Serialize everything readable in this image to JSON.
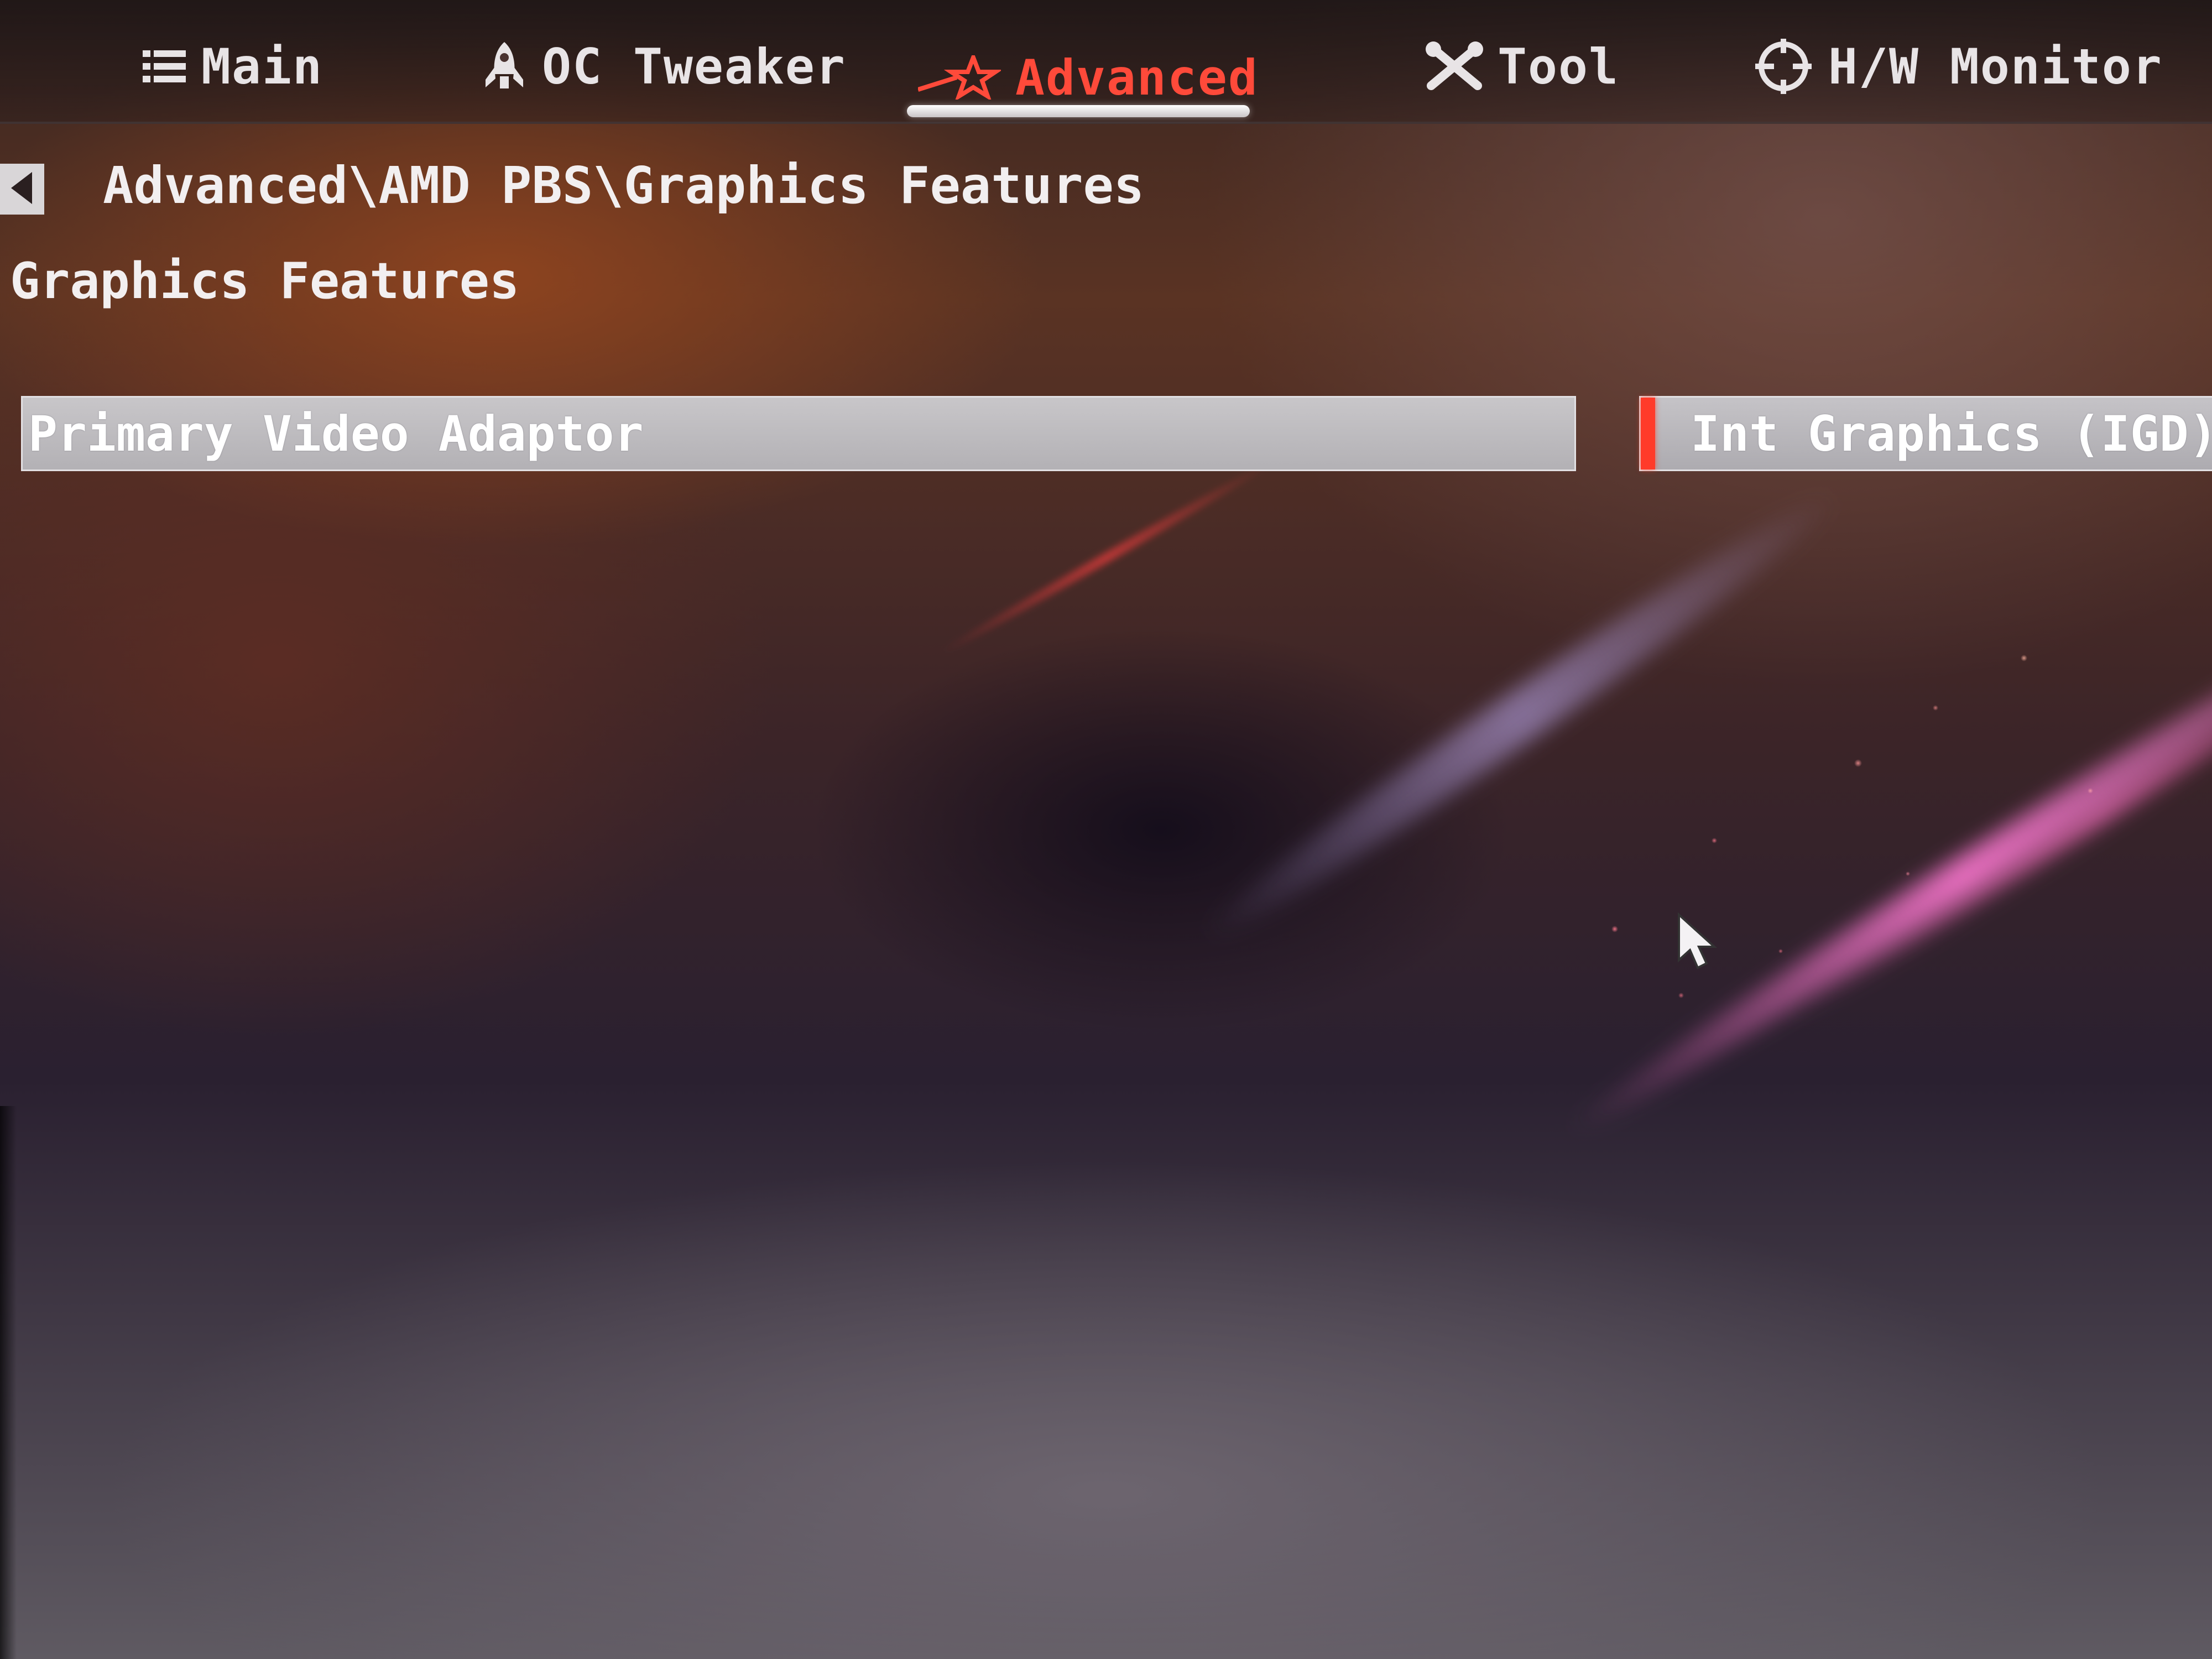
{
  "nav": {
    "tabs": [
      {
        "label": "Main",
        "icon": "list-icon"
      },
      {
        "label": "OC Tweaker",
        "icon": "rocket-icon"
      },
      {
        "label": "Advanced",
        "icon": "star-icon",
        "active": true
      },
      {
        "label": "Tool",
        "icon": "tools-icon"
      },
      {
        "label": "H/W Monitor",
        "icon": "crosshair-icon"
      }
    ]
  },
  "breadcrumb": "Advanced\\AMD PBS\\Graphics Features",
  "section_title": "Graphics Features",
  "settings": [
    {
      "label": "Primary Video Adaptor",
      "value": "Int Graphics (IGD)"
    }
  ],
  "colors": {
    "active_tab": "#ff4a3a",
    "value_marker": "#ff3b2a",
    "text": "#f2eff0",
    "selected_row": "#c0bec2"
  }
}
